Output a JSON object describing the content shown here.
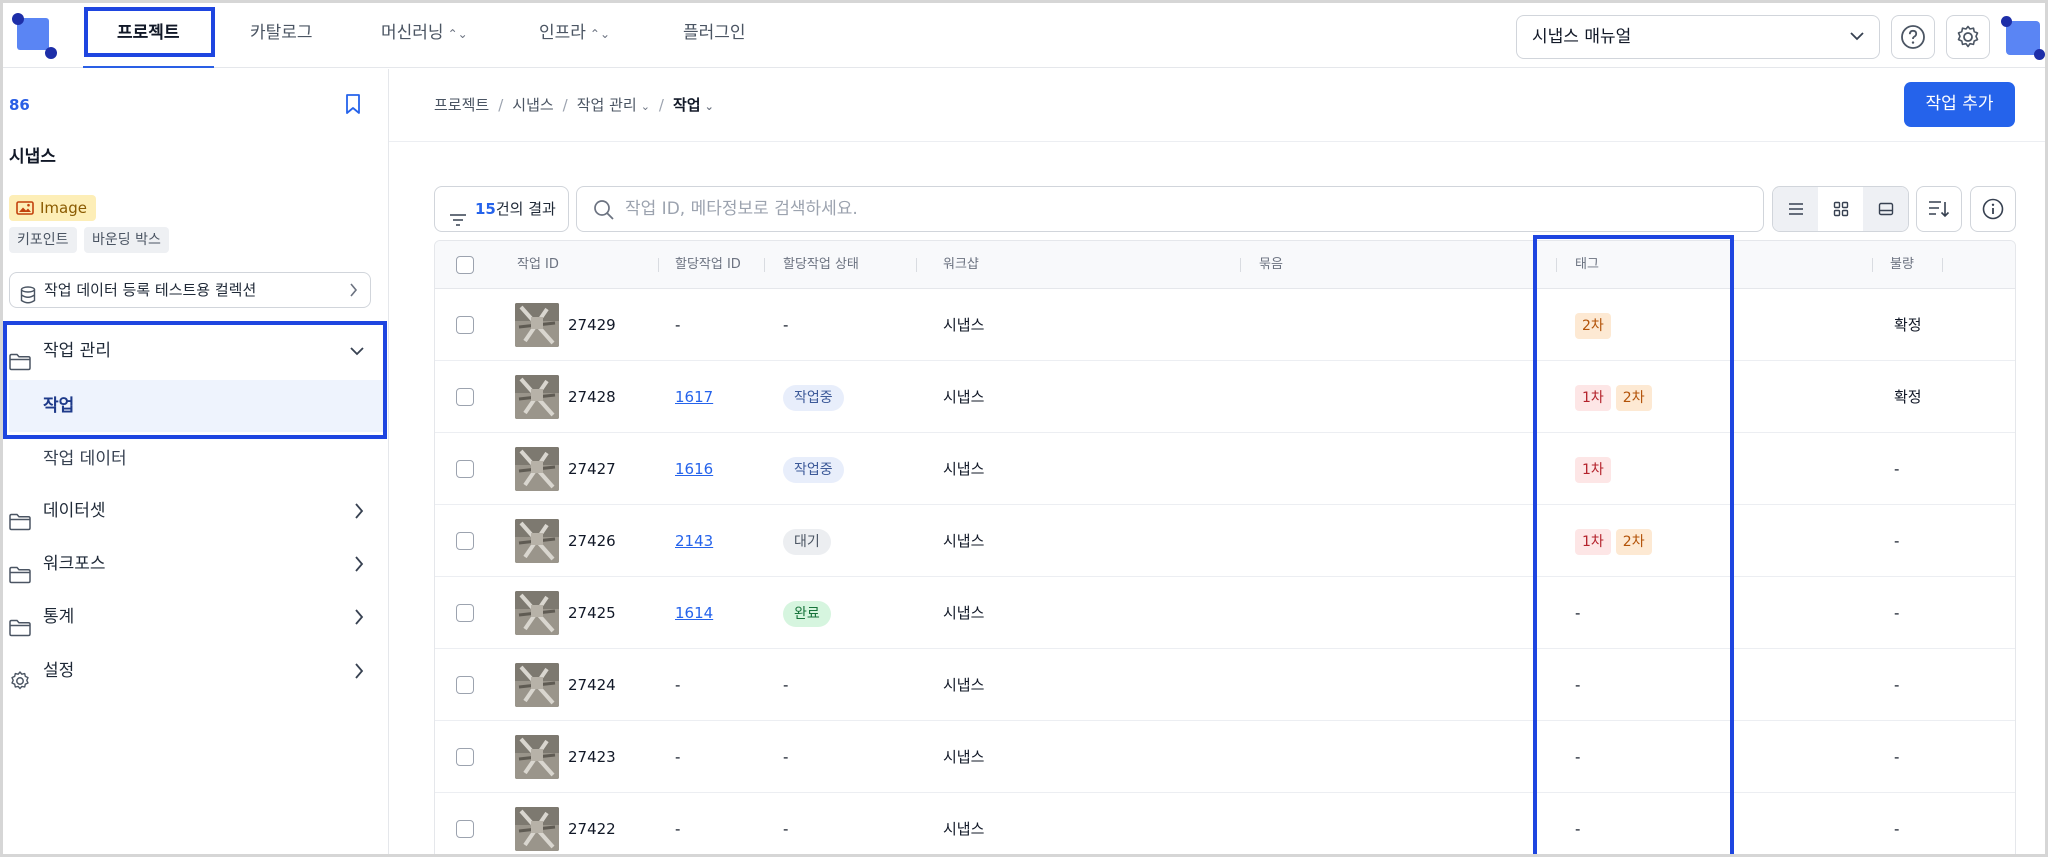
{
  "topnav": {
    "tabs": [
      {
        "label": "프로젝트",
        "has_chevron": false,
        "active": true
      },
      {
        "label": "카탈로그",
        "has_chevron": false,
        "active": false
      },
      {
        "label": "머신러닝",
        "has_chevron": true,
        "active": false
      },
      {
        "label": "인프라",
        "has_chevron": true,
        "active": false
      },
      {
        "label": "플러그인",
        "has_chevron": false,
        "active": false
      }
    ],
    "manual_select": "시냅스 매뉴얼",
    "icons": [
      "logo-icon",
      "help-icon",
      "settings-icon",
      "avatar"
    ]
  },
  "sidebar": {
    "project_id": "86",
    "project_name": "시냅스",
    "type_badge": "Image",
    "chips": [
      "키포인트",
      "바운딩 박스"
    ],
    "collection": "작업 데이터 등록 테스트용 컬렉션",
    "menu": {
      "work_management": "작업 관리",
      "work": "작업",
      "work_data": "작업 데이터",
      "dataset": "데이터셋",
      "workforce": "워크포스",
      "stats": "통계",
      "settings": "설정"
    }
  },
  "main": {
    "breadcrumb": [
      "프로젝트",
      "시냅스",
      "작업 관리",
      "작업"
    ],
    "add_button": "작업 추가",
    "result_count": "15",
    "result_suffix": "건의 결과",
    "search_placeholder": "작업 ID, 메타정보로 검색하세요.",
    "columns": {
      "task_id": "작업 ID",
      "assign_id": "할당작업 ID",
      "assign_status": "할당작업 상태",
      "workshop": "워크샵",
      "bundle": "묶음",
      "tag": "태그",
      "defect": "불량"
    },
    "rows": [
      {
        "task_id": "27429",
        "assign_id": "-",
        "status": "-",
        "status_kind": "none",
        "workshop": "시냅스",
        "tags": [
          "2차"
        ],
        "defect": "확정"
      },
      {
        "task_id": "27428",
        "assign_id": "1617",
        "status": "작업중",
        "status_kind": "working",
        "workshop": "시냅스",
        "tags": [
          "1차",
          "2차"
        ],
        "defect": "확정"
      },
      {
        "task_id": "27427",
        "assign_id": "1616",
        "status": "작업중",
        "status_kind": "working",
        "workshop": "시냅스",
        "tags": [
          "1차"
        ],
        "defect": "-"
      },
      {
        "task_id": "27426",
        "assign_id": "2143",
        "status": "대기",
        "status_kind": "waiting",
        "workshop": "시냅스",
        "tags": [
          "1차",
          "2차"
        ],
        "defect": "-"
      },
      {
        "task_id": "27425",
        "assign_id": "1614",
        "status": "완료",
        "status_kind": "done",
        "workshop": "시냅스",
        "tags": [],
        "defect": "-"
      },
      {
        "task_id": "27424",
        "assign_id": "-",
        "status": "-",
        "status_kind": "none",
        "workshop": "시냅스",
        "tags": [],
        "defect": "-"
      },
      {
        "task_id": "27423",
        "assign_id": "-",
        "status": "-",
        "status_kind": "none",
        "workshop": "시냅스",
        "tags": [],
        "defect": "-"
      },
      {
        "task_id": "27422",
        "assign_id": "-",
        "status": "-",
        "status_kind": "none",
        "workshop": "시냅스",
        "tags": [],
        "defect": "-"
      }
    ]
  },
  "colors": {
    "accent": "#2563eb",
    "highlight_box": "#1e45e0",
    "tag_first": "#fde6e6",
    "tag_second": "#fde9d3",
    "status_done": "#d6f5df"
  }
}
